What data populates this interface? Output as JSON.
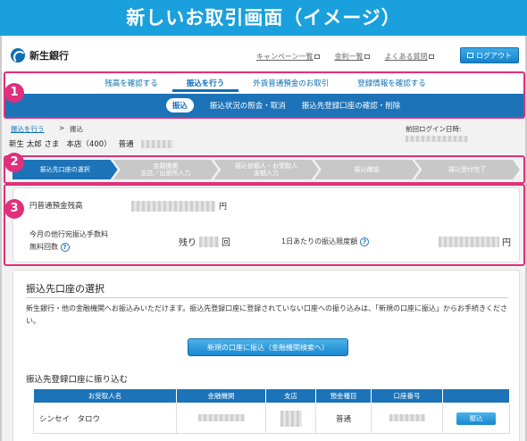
{
  "banner": {
    "title": "新しいお取引画面（イメージ）"
  },
  "header": {
    "brand": "新生銀行",
    "links": [
      "キャンペーン一覧",
      "金利一覧",
      "よくある質問"
    ],
    "logout": "ログアウト"
  },
  "nav": {
    "tabs": [
      "残高を確認する",
      "振込を行う",
      "外貨普通預金のお取引",
      "登録情報を確認する"
    ],
    "active_tab": "振込を行う",
    "subnav": [
      "振込",
      "振込状況の照会・取消",
      "振込先登録口座の確認・削除"
    ]
  },
  "breadcrumb": {
    "link": "振込を行う",
    "sep": ">",
    "current": "振込",
    "last_login_label": "前回ログイン日時:"
  },
  "account": {
    "name": "新生 太郎 さま",
    "branch": "本店（400）",
    "type": "普通"
  },
  "steps": [
    "振込先口座の選択",
    "金融機関\n支店／出張所入力",
    "振込依頼人・お受取人\n金額入力",
    "振込確認",
    "振込受付完了"
  ],
  "balance": {
    "label": "円普通預金残高",
    "unit": "円",
    "fee_label_line1": "今月の他行宛振込手数料",
    "fee_label_line2": "無料回数",
    "remain_prefix": "残り",
    "remain_unit": "回",
    "limit_label": "1日あたりの振込限度額",
    "limit_unit": "円"
  },
  "badges": [
    "1",
    "2",
    "3"
  ],
  "main": {
    "title": "振込先口座の選択",
    "desc": "新生銀行・他の金融機関へお振込みいただけます。振込先登録口座に登録されていない口座への振り込みは、「新規の口座に振込」からお手続きください。",
    "new_button": "新規の口座に振込（金融機関検索へ）",
    "section": "振込先登録口座に振り込む",
    "columns": [
      "お受取人名",
      "金融機関",
      "支店",
      "預金種目",
      "口座番号",
      ""
    ],
    "rows": [
      {
        "name": "シンセイ　タロウ",
        "type": "普通",
        "action": "振込"
      }
    ]
  },
  "colors": {
    "accent": "#1c73b8",
    "highlight": "#e0307a",
    "banner": "#1aa0dc"
  }
}
